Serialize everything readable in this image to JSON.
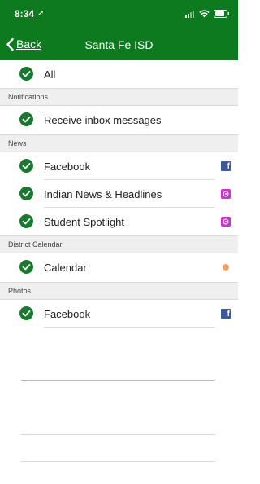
{
  "status_bar": {
    "time": "8:34"
  },
  "nav": {
    "back_label": "Back",
    "title": "Santa Fe ISD"
  },
  "all_row": {
    "label": "All"
  },
  "sections": {
    "notifications": "Notifications",
    "news": "News",
    "district_calendar": "District Calendar",
    "photos": "Photos"
  },
  "items": {
    "receive_inbox": {
      "label": "Receive inbox messages"
    },
    "news_facebook": {
      "label": "Facebook",
      "icon": "facebook-icon"
    },
    "indian_news": {
      "label": "Indian News & Headlines",
      "icon": "news-feed-icon"
    },
    "student_spotlight": {
      "label": "Student Spotlight",
      "icon": "news-feed-icon"
    },
    "calendar": {
      "label": "Calendar",
      "icon": "calendar-dot-icon"
    },
    "photos_facebook": {
      "label": "Facebook",
      "icon": "facebook-icon"
    }
  },
  "colors": {
    "brand_green": "#0e7a1f",
    "check_green": "#187a2c",
    "facebook_blue": "#3b5998",
    "feed_pink": "#cc33cc",
    "calendar_orange": "#f6a25f"
  }
}
